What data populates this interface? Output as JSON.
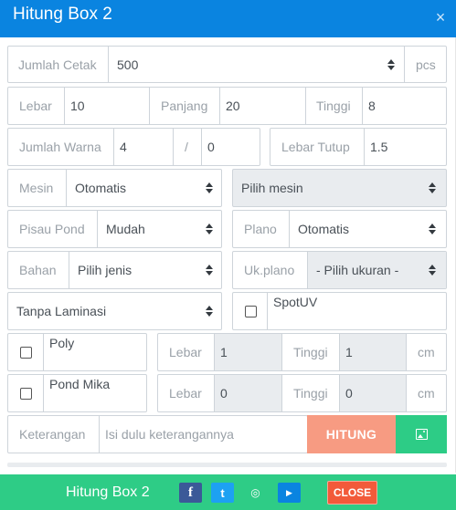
{
  "modal": {
    "title": "Hitung Box 2",
    "close_glyph": "×"
  },
  "form": {
    "jumlah_cetak": {
      "label": "Jumlah Cetak",
      "value": "500",
      "unit": "pcs"
    },
    "lebar": {
      "label": "Lebar",
      "value": "10"
    },
    "panjang": {
      "label": "Panjang",
      "value": "20"
    },
    "tinggi": {
      "label": "Tinggi",
      "value": "8"
    },
    "jumlah_warna": {
      "label": "Jumlah Warna",
      "value1": "4",
      "separator": "/",
      "value2": "0"
    },
    "lebar_tutup": {
      "label": "Lebar Tutup",
      "value": "1.5"
    },
    "mesin": {
      "label": "Mesin",
      "value": "Otomatis"
    },
    "pilih_mesin": {
      "value": "Pilih mesin"
    },
    "pisau_pond": {
      "label": "Pisau Pond",
      "value": "Mudah"
    },
    "plano": {
      "label": "Plano",
      "value": "Otomatis"
    },
    "bahan": {
      "label": "Bahan",
      "value": "Pilih jenis"
    },
    "uk_plano": {
      "label": "Uk.plano",
      "value": "- Pilih ukuran -"
    },
    "laminasi": {
      "value": "Tanpa Laminasi"
    },
    "spotuv": {
      "label": "SpotUV",
      "checked": false
    },
    "poly": {
      "label": "Poly",
      "checked": false,
      "lebar_label": "Lebar",
      "lebar_value": "1",
      "tinggi_label": "Tinggi",
      "tinggi_value": "1",
      "unit": "cm"
    },
    "pond_mika": {
      "label": "Pond Mika",
      "checked": false,
      "lebar_label": "Lebar",
      "lebar_value": "0",
      "tinggi_label": "Tinggi",
      "tinggi_value": "0",
      "unit": "cm"
    },
    "keterangan": {
      "label": "Keterangan",
      "placeholder": "Isi dulu keterangannya"
    },
    "hitung_label": "HITUNG",
    "image_button_icon": "image-icon"
  },
  "footer": {
    "title": "Hitung Box 2",
    "social": [
      {
        "name": "facebook-icon",
        "glyph": "f",
        "color": "#3b5998"
      },
      {
        "name": "twitter-icon",
        "glyph": "t",
        "color": "#1da1f2"
      },
      {
        "name": "instagram-icon",
        "glyph": "◎",
        "color": "#2ecc86"
      },
      {
        "name": "youtube-icon",
        "glyph": "▶",
        "color": "#0a84e0"
      }
    ],
    "close_label": "CLOSE"
  },
  "colors": {
    "header": "#0a84e0",
    "footer": "#2ecc86",
    "hitung": "#f79b82",
    "image_button": "#2dcc86",
    "close": "#f25a3a"
  }
}
